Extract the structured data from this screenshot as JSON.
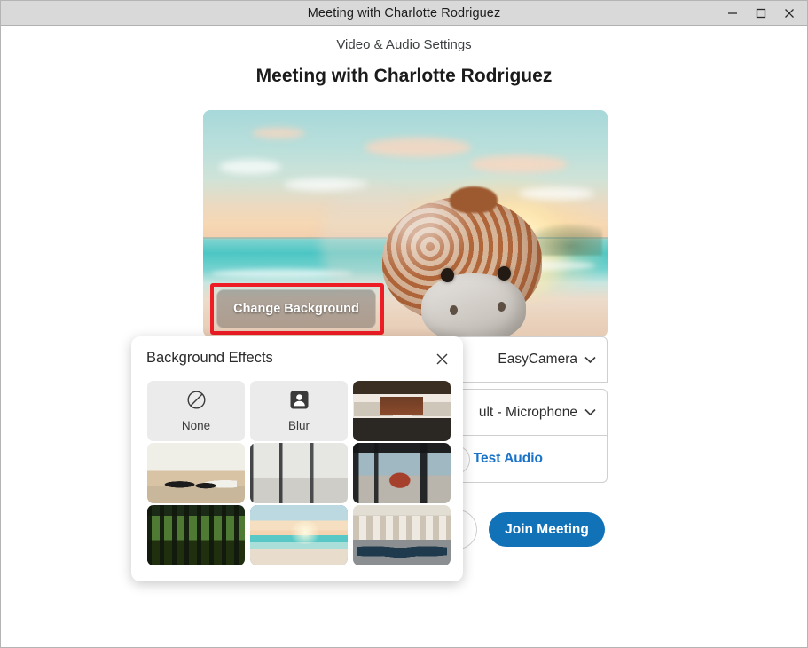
{
  "window": {
    "title": "Meeting with Charlotte Rodriguez",
    "minimize_label": "Minimize",
    "maximize_label": "Maximize",
    "close_label": "Close"
  },
  "header": {
    "subtitle": "Video & Audio Settings",
    "title": "Meeting with Charlotte Rodriguez"
  },
  "video_preview": {
    "change_background_label": "Change Background",
    "highlight_color": "#ee1c25"
  },
  "controls": {
    "camera_label": "EasyCamera",
    "camera_chevron": "⌄",
    "microphone_label": "ult - Microphone",
    "microphone_full_label": "Default - Microphone",
    "microphone_chevron": "⌄",
    "test_audio_label": "Test Audio",
    "test_audio_color": "#1a73c8",
    "join_meeting_label": "Join Meeting",
    "join_button_color": "#1272b8"
  },
  "background_effects": {
    "title": "Background Effects",
    "close_label": "×",
    "selected_index": 7,
    "selected_border_color": "#1a73c8",
    "tiles": [
      {
        "name": "none",
        "type": "flat",
        "label": "None",
        "icon": "no-entry-icon"
      },
      {
        "name": "blur",
        "type": "flat",
        "label": "Blur",
        "icon": "person-blur-icon"
      },
      {
        "name": "office-lobby",
        "type": "image",
        "label": "",
        "art": "th-lobby"
      },
      {
        "name": "living-room",
        "type": "image",
        "label": "",
        "art": "th-living"
      },
      {
        "name": "glass-hallway",
        "type": "image",
        "label": "",
        "art": "th-hall"
      },
      {
        "name": "modern-office",
        "type": "image",
        "label": "",
        "art": "th-hall2"
      },
      {
        "name": "forest",
        "type": "image",
        "label": "",
        "art": "th-forest"
      },
      {
        "name": "beach-sunset",
        "type": "image",
        "label": "",
        "art": "th-beach"
      },
      {
        "name": "stone-arches",
        "type": "image",
        "label": "",
        "art": "th-arches"
      }
    ]
  }
}
